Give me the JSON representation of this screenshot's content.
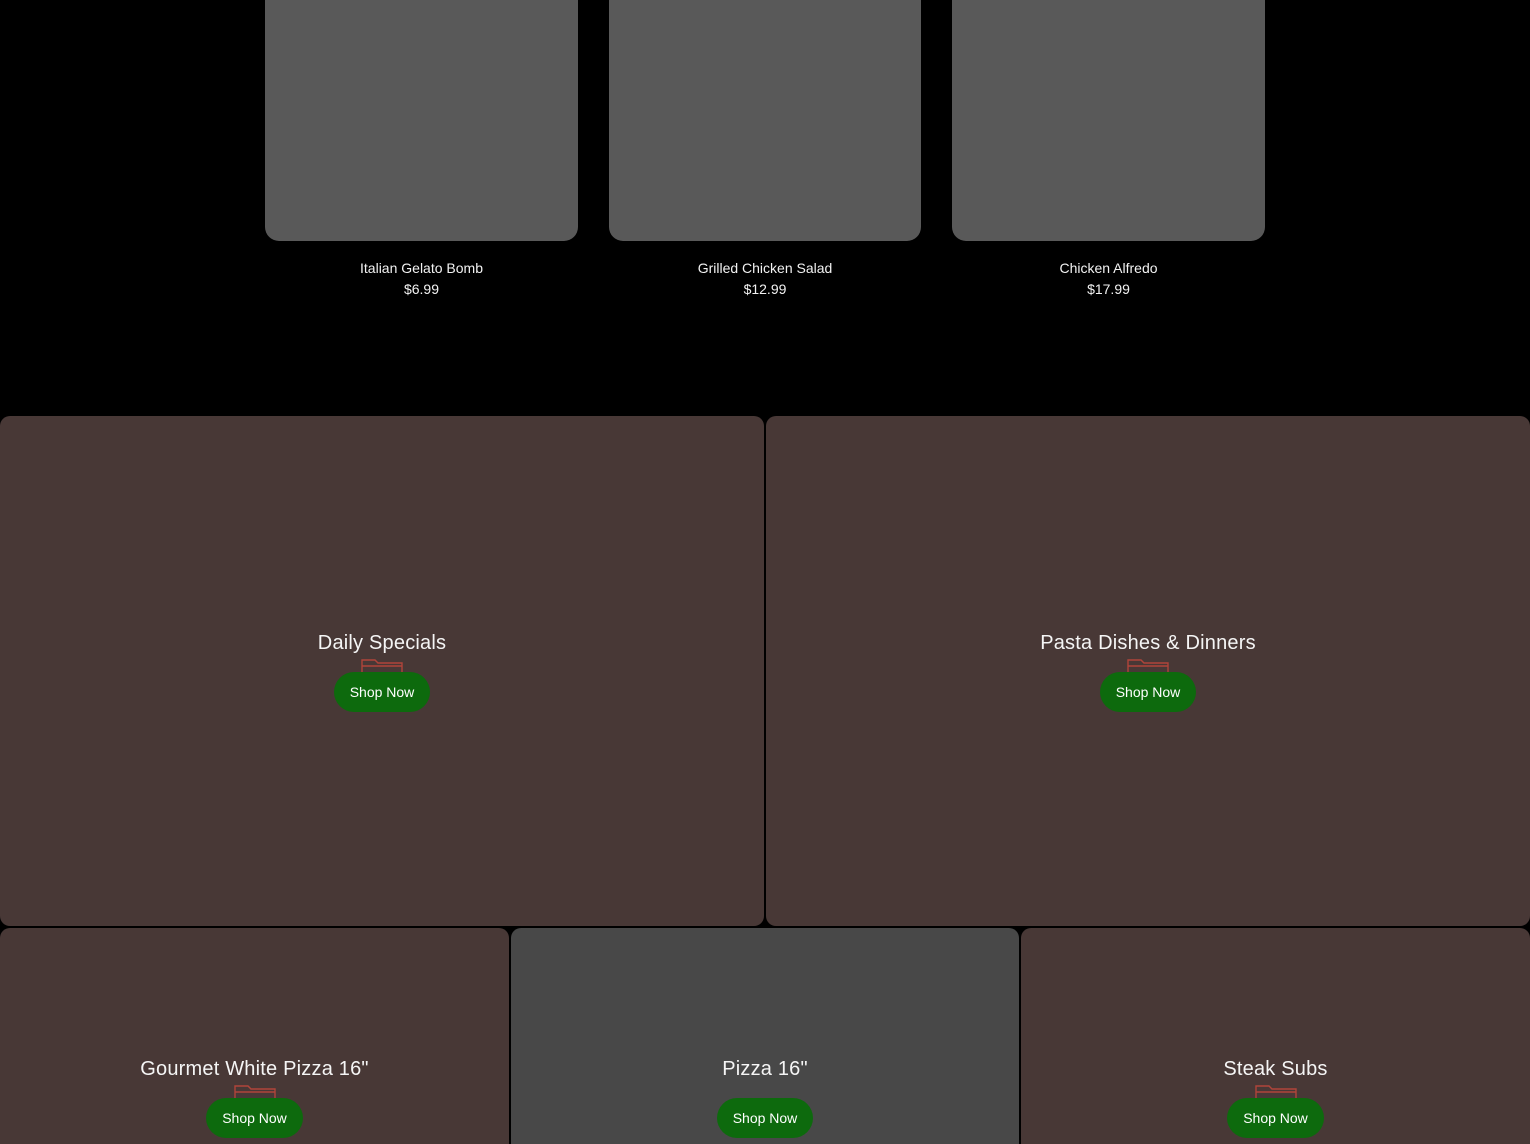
{
  "products": [
    {
      "name": "Italian Gelato Bomb",
      "price": "$6.99"
    },
    {
      "name": "Grilled Chicken Salad",
      "price": "$12.99"
    },
    {
      "name": "Chicken Alfredo",
      "price": "$17.99"
    }
  ],
  "categories": [
    {
      "title": "Daily Specials",
      "button": "Shop Now",
      "icon": "folder-icon"
    },
    {
      "title": "Pasta Dishes & Dinners",
      "button": "Shop Now",
      "icon": "folder-icon"
    },
    {
      "title": "Gourmet White Pizza 16\"",
      "button": "Shop Now",
      "icon": "folder-icon"
    },
    {
      "title": "Pizza 16\"",
      "button": "Shop Now"
    },
    {
      "title": "Steak Subs",
      "button": "Shop Now",
      "icon": "folder-icon"
    }
  ],
  "colors": {
    "background": "#000000",
    "product_placeholder": "#595959",
    "tile_brown": "#483836",
    "tile_gray": "#484848",
    "button_green": "#0d6a0d",
    "icon_red": "#b0443a"
  }
}
